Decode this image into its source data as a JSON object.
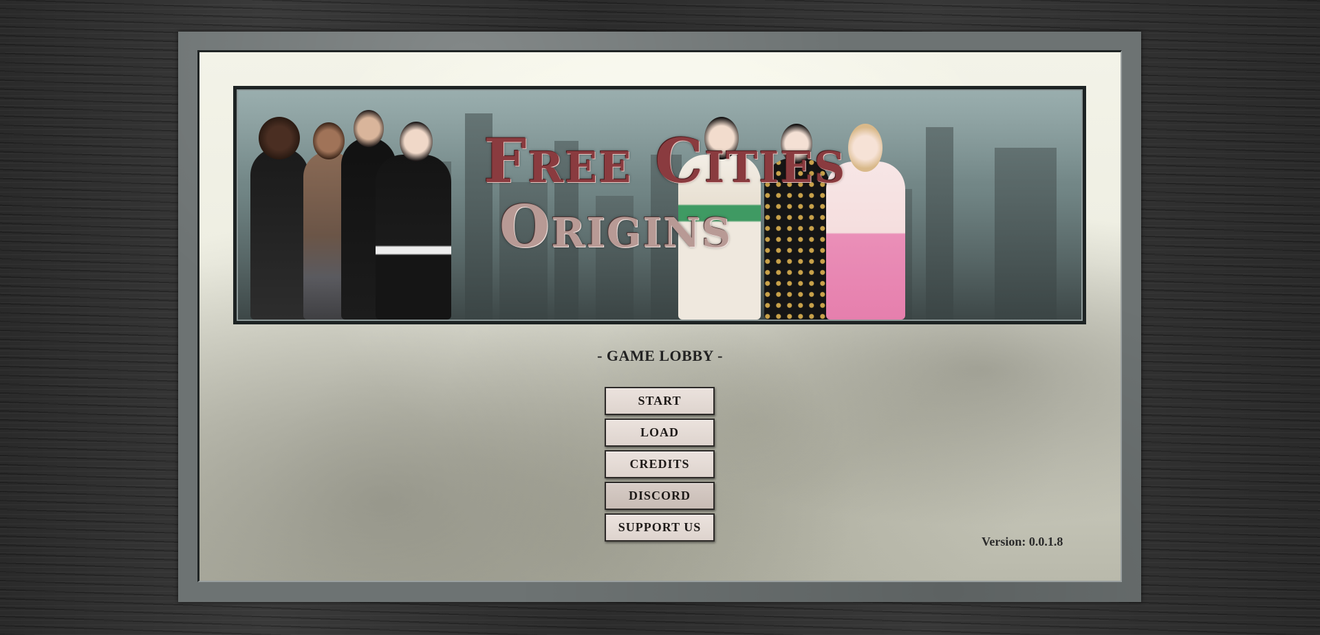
{
  "banner": {
    "logo_line1": "Free Cities",
    "logo_line2": "Origins"
  },
  "lobby": {
    "title": "- GAME LOBBY -"
  },
  "menu": {
    "items": [
      {
        "label": "START"
      },
      {
        "label": "LOAD"
      },
      {
        "label": "CREDITS"
      },
      {
        "label": "DISCORD"
      },
      {
        "label": "SUPPORT US"
      }
    ]
  },
  "footer": {
    "version": "Version: 0.0.1.8"
  },
  "colors": {
    "frame": "#6d7373",
    "button_bg": "#e6ddd8",
    "logo_red": "#8a3b3f"
  }
}
